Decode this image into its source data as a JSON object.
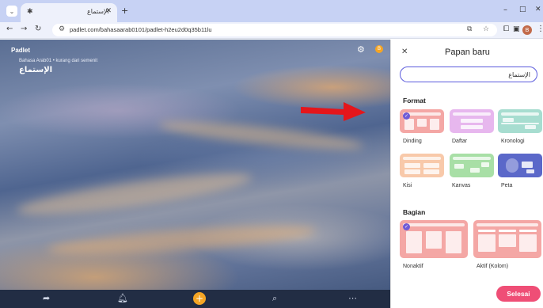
{
  "browser": {
    "tab_title": "الإستماع",
    "url": "padlet.com/bahasaarab0101/padlet-h2eu2d0q35b11lu",
    "profile_initial": "B",
    "icons": [
      "chevron-down-icon",
      "close-icon",
      "plus-icon",
      "back-arrow-icon",
      "forward-arrow-icon",
      "reload-icon",
      "site-settings-icon",
      "star-icon",
      "extensions-icon",
      "menu-icon"
    ]
  },
  "board": {
    "brand": "Padlet",
    "subtitle": "Bahasa Arab01 • kurang dari semenit",
    "title": "الإستماع",
    "user_initial": "B"
  },
  "panel": {
    "title": "Papan baru",
    "close_label": "×",
    "input_value": "الإستماع",
    "format_heading": "Format",
    "formats": [
      {
        "label": "Dinding",
        "color": "#f4a7a5",
        "selected": true
      },
      {
        "label": "Daftar",
        "color": "#e7b7ee",
        "selected": false
      },
      {
        "label": "Kronologi",
        "color": "#a7ddd0",
        "selected": false
      },
      {
        "label": "Kisi",
        "color": "#f8c9aa",
        "selected": false
      },
      {
        "label": "Kanvas",
        "color": "#a8dfa6",
        "selected": false
      },
      {
        "label": "Peta",
        "color": "#5b68c9",
        "selected": false
      }
    ],
    "section_heading": "Bagian",
    "sections": [
      {
        "label": "Nonaktif",
        "color": "#f4a7a5",
        "selected": true
      },
      {
        "label": "Aktif (Kolom)",
        "color": "#f4a7a5",
        "selected": false
      }
    ],
    "done_label": "Selesai",
    "accent": "#ef4e76",
    "check_color": "#6f5bd6"
  }
}
